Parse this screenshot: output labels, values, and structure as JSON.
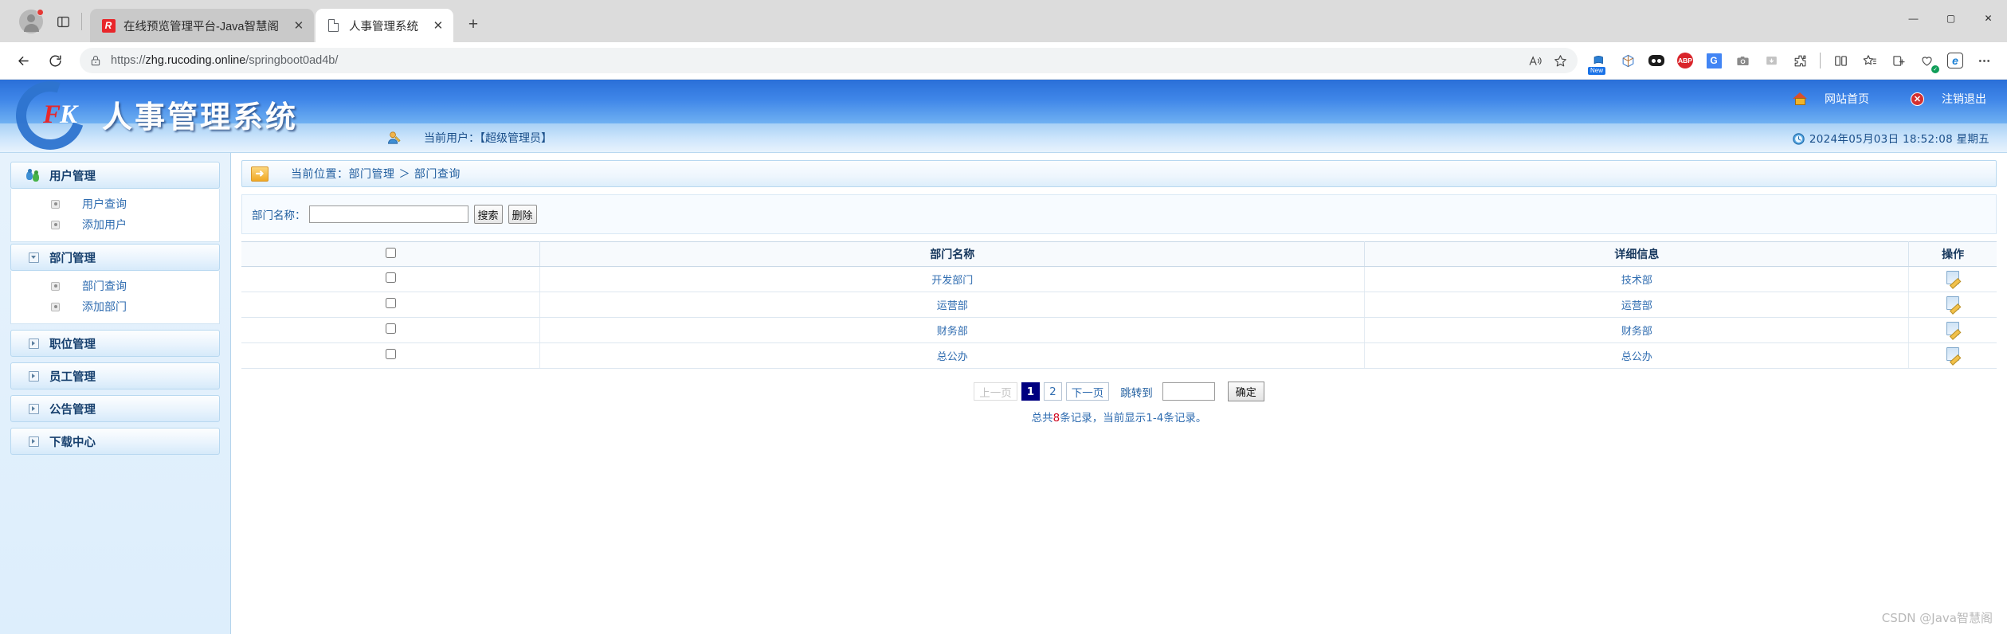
{
  "browser": {
    "tabs": [
      {
        "title": "在线预览管理平台-Java智慧阁",
        "active": false,
        "favicon": "red-square-icon"
      },
      {
        "title": "人事管理系统",
        "active": true,
        "favicon": "document-icon"
      }
    ],
    "new_tab_label": "+",
    "close_label": "✕",
    "window_controls": {
      "minimize": "—",
      "maximize": "▢",
      "close": "✕"
    },
    "url": {
      "scheme": "https://",
      "host": "zhg.rucoding.online",
      "path": "/springboot0ad4b/"
    },
    "nav": {
      "back": "←",
      "reload": "⟳"
    },
    "toolbar_icons": [
      "read-aloud-icon",
      "add-favorite-icon",
      "collections-new-icon",
      "split-screen-3d-icon",
      "pocket-icon",
      "adblock-plus-icon",
      "google-translate-icon",
      "screenshot-icon",
      "downloads-icon",
      "extensions-icon",
      "split-screen-icon",
      "favorites-icon",
      "collections-icon",
      "browser-essentials-icon",
      "ie-mode-icon",
      "settings-more-icon"
    ]
  },
  "app": {
    "logo": {
      "mark_f": "F",
      "mark_k": "K",
      "title": "人事管理系统"
    },
    "header_links": [
      {
        "label": "网站首页",
        "icon": "home-icon"
      },
      {
        "label": "注销退出",
        "icon": "logout-icon"
      }
    ],
    "user_bar": {
      "icon": "user-icon",
      "current_user_text": "当前用户：【超级管理员】",
      "clock_icon": "clock-icon",
      "datetime": "2024年05月03日 18:52:08 星期五"
    }
  },
  "sidebar": {
    "groups": [
      {
        "label": "用户管理",
        "icon": "users-icon",
        "expanded": true,
        "items": [
          {
            "label": "用户查询"
          },
          {
            "label": "添加用户"
          }
        ]
      },
      {
        "label": "部门管理",
        "icon": "expand-open-icon",
        "expanded": true,
        "items": [
          {
            "label": "部门查询"
          },
          {
            "label": "添加部门"
          }
        ]
      },
      {
        "label": "职位管理",
        "icon": "expand-closed-icon",
        "expanded": false,
        "items": []
      },
      {
        "label": "员工管理",
        "icon": "expand-closed-icon",
        "expanded": false,
        "items": []
      },
      {
        "label": "公告管理",
        "icon": "expand-closed-icon",
        "expanded": false,
        "items": []
      },
      {
        "label": "下载中心",
        "icon": "expand-closed-icon",
        "expanded": false,
        "items": []
      }
    ]
  },
  "main": {
    "breadcrumb": {
      "icon": "arrow-right-icon",
      "text": "当前位置：部门管理 ＞ 部门查询"
    },
    "search": {
      "label": "部门名称：",
      "value": "",
      "placeholder": "",
      "search_button": "搜索",
      "delete_button": "删除"
    },
    "table": {
      "headers": [
        "",
        "部门名称",
        "详细信息",
        "操作"
      ],
      "select_all_checked": false,
      "rows": [
        {
          "checked": false,
          "name": "开发部门",
          "detail": "技术部",
          "action_icon": "edit-icon"
        },
        {
          "checked": false,
          "name": "运营部",
          "detail": "运营部",
          "action_icon": "edit-icon"
        },
        {
          "checked": false,
          "name": "财务部",
          "detail": "财务部",
          "action_icon": "edit-icon"
        },
        {
          "checked": false,
          "name": "总公办",
          "detail": "总公办",
          "action_icon": "edit-icon"
        }
      ]
    },
    "pagination": {
      "prev_label": "上一页",
      "prev_disabled": true,
      "pages": [
        {
          "label": "1",
          "active": true
        },
        {
          "label": "2",
          "active": false
        }
      ],
      "next_label": "下一页",
      "jump_label": "跳转到",
      "jump_value": "",
      "confirm_label": "确定",
      "status_prefix": "总共",
      "status_count": "8",
      "status_suffix": "条记录，当前显示1-4条记录。"
    }
  },
  "watermark": "CSDN @Java智慧阁"
}
